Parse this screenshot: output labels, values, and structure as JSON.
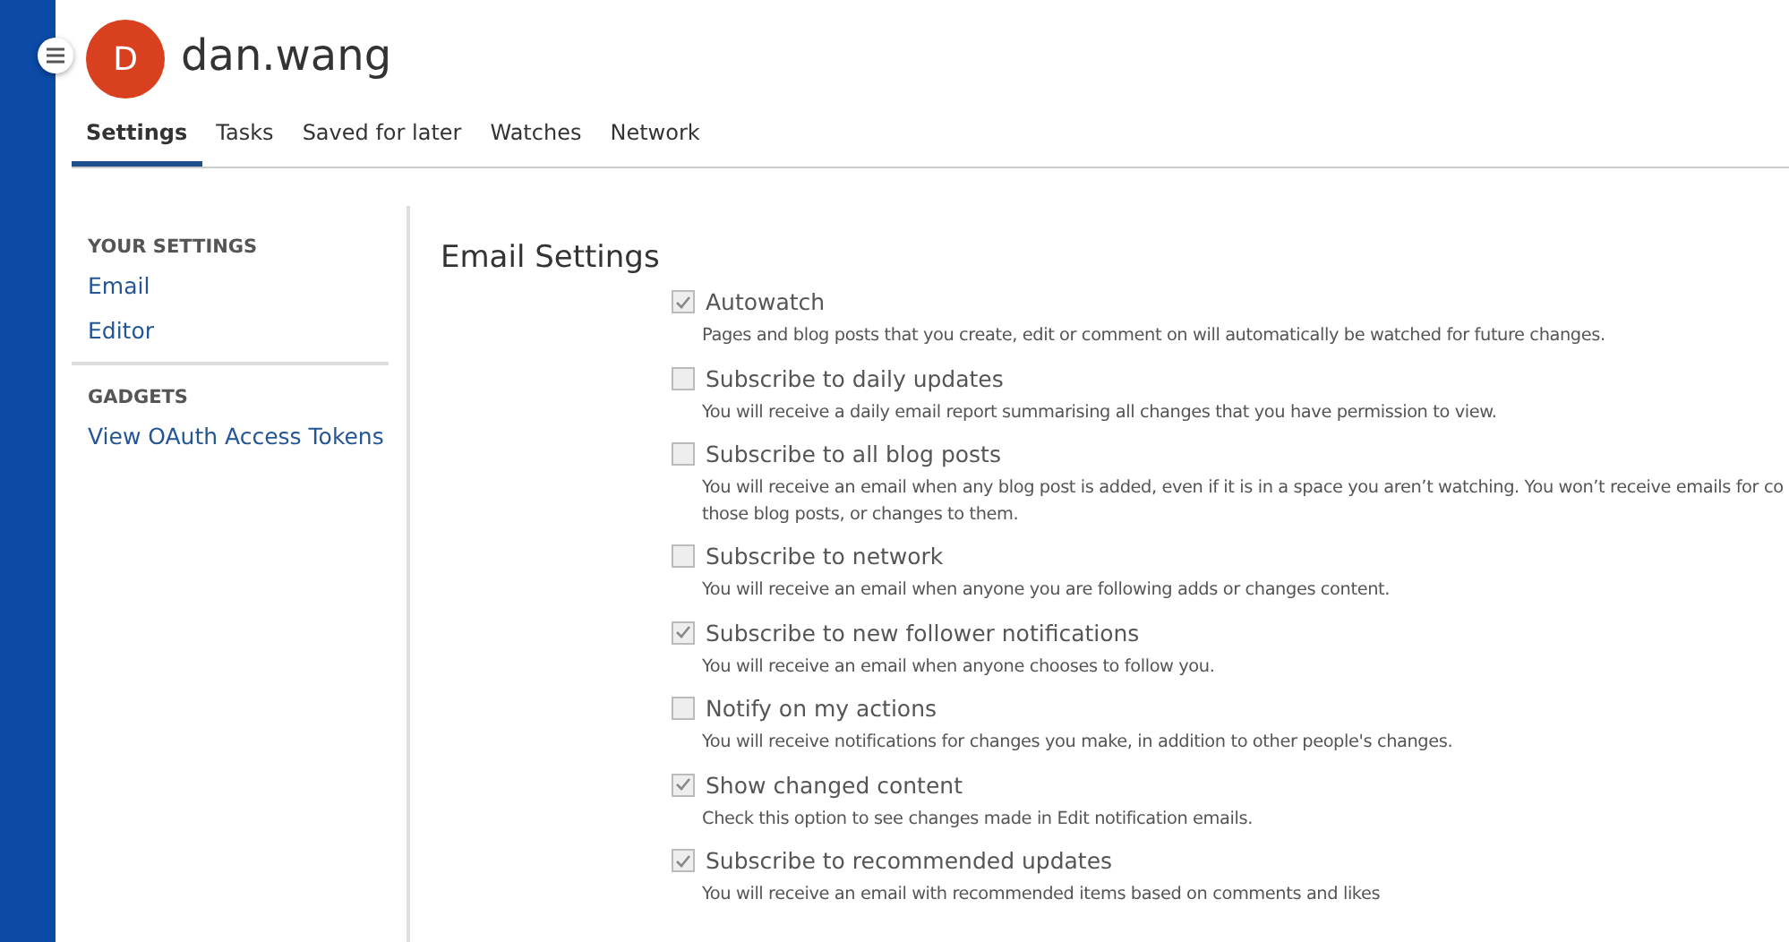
{
  "user": {
    "initial": "D",
    "name": "dan.wang"
  },
  "tabs": [
    {
      "label": "Settings",
      "selected": true
    },
    {
      "label": "Tasks",
      "selected": false
    },
    {
      "label": "Saved for later",
      "selected": false
    },
    {
      "label": "Watches",
      "selected": false
    },
    {
      "label": "Network",
      "selected": false
    }
  ],
  "sidebar": {
    "sections": [
      {
        "heading": "YOUR SETTINGS",
        "items": [
          "Email",
          "Editor"
        ]
      },
      {
        "heading": "GADGETS",
        "items": [
          "View OAuth Access Tokens"
        ]
      }
    ]
  },
  "content": {
    "title": "Email Settings",
    "options": [
      {
        "label": "Autowatch",
        "checked": true,
        "description": [
          "Pages and blog posts that you create, edit or comment on will automatically be watched for future changes."
        ]
      },
      {
        "label": "Subscribe to daily updates",
        "checked": false,
        "description": [
          "You will receive a daily email report summarising all changes that you have permission to view."
        ]
      },
      {
        "label": "Subscribe to all blog posts",
        "checked": false,
        "description": [
          "You will receive an email when any blog post is added, even if it is in a space you aren’t watching. You won’t receive emails for co",
          "those blog posts, or changes to them."
        ]
      },
      {
        "label": "Subscribe to network",
        "checked": false,
        "description": [
          "You will receive an email when anyone you are following adds or changes content."
        ]
      },
      {
        "label": "Subscribe to new follower notifications",
        "checked": true,
        "description": [
          "You will receive an email when anyone chooses to follow you."
        ]
      },
      {
        "label": "Notify on my actions",
        "checked": false,
        "description": [
          "You will receive notifications for changes you make, in addition to other people's changes."
        ]
      },
      {
        "label": "Show changed content",
        "checked": true,
        "description": [
          "Check this option to see changes made in Edit notification emails."
        ]
      },
      {
        "label": "Subscribe to recommended updates",
        "checked": true,
        "description": [
          "You will receive an email with recommended items based on comments and likes"
        ]
      }
    ]
  }
}
